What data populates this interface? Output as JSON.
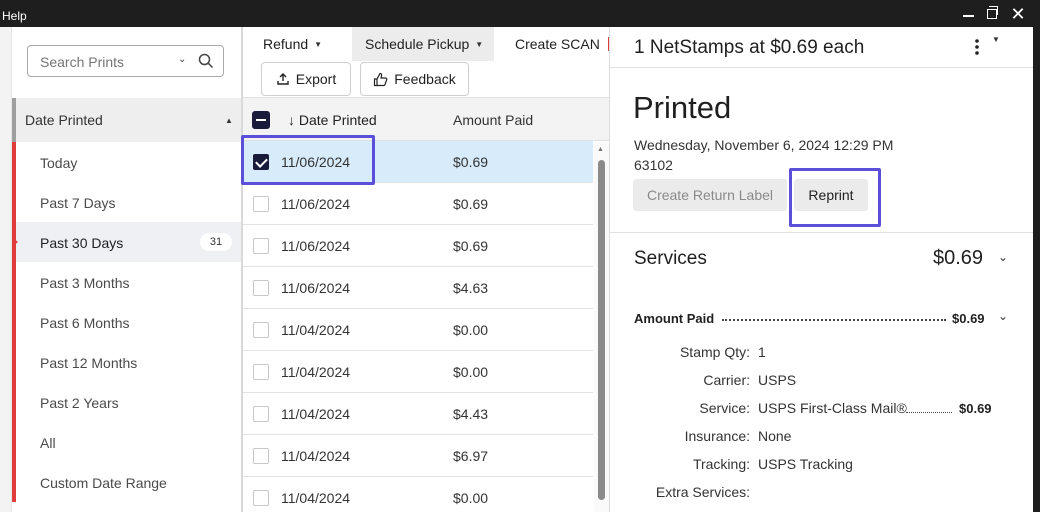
{
  "titlebar": {
    "menu_help": "Help",
    "minimize_icon": "minimize-icon",
    "maximize_icon": "maximize-icon",
    "close_icon": "close-icon"
  },
  "filters": {
    "search_placeholder": "Search Prints",
    "header_label": "Date Printed",
    "items": [
      {
        "label": "Today"
      },
      {
        "label": "Past 7 Days"
      },
      {
        "label": "Past 30 Days",
        "count": "31",
        "active": true
      },
      {
        "label": "Past 3 Months"
      },
      {
        "label": "Past 6 Months"
      },
      {
        "label": "Past 12 Months"
      },
      {
        "label": "Past 2 Years"
      },
      {
        "label": "All"
      },
      {
        "label": "Custom Date Range"
      }
    ]
  },
  "toolbar": {
    "refund": "Refund",
    "schedule_pickup": "Schedule Pickup",
    "create_scan": "Create SCAN",
    "export": "Export",
    "feedback": "Feedback"
  },
  "list": {
    "col_date": "↓ Date Printed",
    "col_amount": "Amount Paid",
    "rows": [
      {
        "date": "11/06/2024",
        "amount": "$0.69",
        "checked": true
      },
      {
        "date": "11/06/2024",
        "amount": "$0.69"
      },
      {
        "date": "11/06/2024",
        "amount": "$0.69"
      },
      {
        "date": "11/06/2024",
        "amount": "$4.63"
      },
      {
        "date": "11/04/2024",
        "amount": "$0.00"
      },
      {
        "date": "11/04/2024",
        "amount": "$0.00"
      },
      {
        "date": "11/04/2024",
        "amount": "$4.43"
      },
      {
        "date": "11/04/2024",
        "amount": "$6.97"
      },
      {
        "date": "11/04/2024",
        "amount": "$0.00"
      }
    ]
  },
  "detail": {
    "title": "1 NetStamps at $0.69 each",
    "status": "Printed",
    "printed_on": "Wednesday, November 6, 2024 12:29 PM",
    "zip": "63102",
    "create_return_label": "Create Return Label",
    "reprint": "Reprint",
    "services_label": "Services",
    "services_total": "$0.69",
    "amount_paid_label": "Amount Paid",
    "amount_paid_value": "$0.69",
    "fields": [
      {
        "label": "Stamp Qty:",
        "value": "1"
      },
      {
        "label": "Carrier:",
        "value": "USPS"
      },
      {
        "label": "Service:",
        "value": "USPS First-Class Mail®"
      },
      {
        "label": "Insurance:",
        "value": "None"
      },
      {
        "label": "Tracking:",
        "value": "USPS Tracking"
      },
      {
        "label": "Extra Services:",
        "value": ""
      }
    ],
    "service_price": "$0.69"
  }
}
